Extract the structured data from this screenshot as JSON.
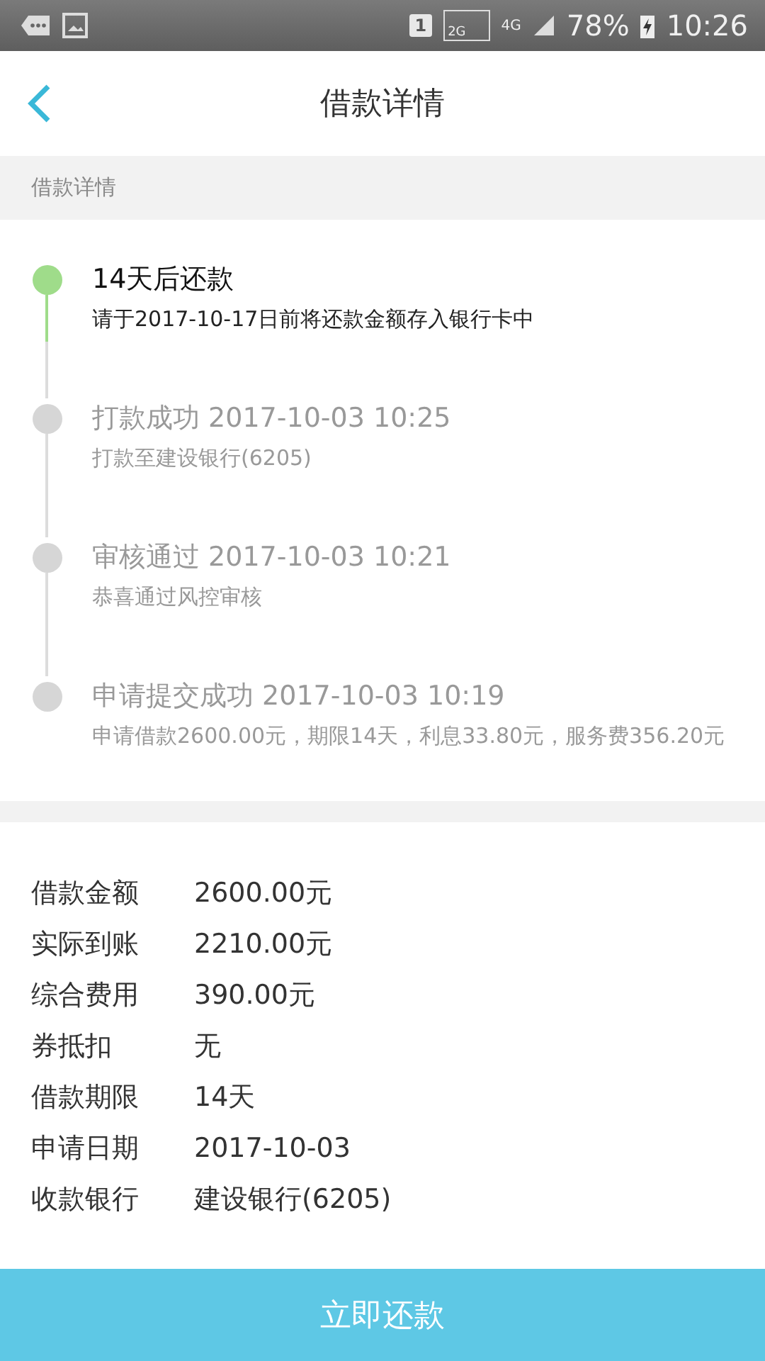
{
  "status_bar": {
    "sim": "1",
    "network_2g": "2G",
    "network_4g": "4G",
    "battery": "78%",
    "time": "10:26"
  },
  "header": {
    "title": "借款详情"
  },
  "section_label": "借款详情",
  "timeline": [
    {
      "title": "14天后还款",
      "subtitle": "请于2017-10-17日前将还款金额存入银行卡中",
      "selected": true
    },
    {
      "title": "打款成功 2017-10-03 10:25",
      "subtitle": "打款至建设银行(6205)",
      "selected": false
    },
    {
      "title": "审核通过 2017-10-03 10:21",
      "subtitle": "恭喜通过风控审核",
      "selected": false
    },
    {
      "title": "申请提交成功 2017-10-03 10:19",
      "subtitle": "申请借款2600.00元，期限14天，利息33.80元，服务费356.20元",
      "selected": false
    }
  ],
  "details": [
    {
      "label": "借款金额",
      "value": "2600.00元"
    },
    {
      "label": "实际到账",
      "value": "2210.00元"
    },
    {
      "label": "综合费用",
      "value": "390.00元"
    },
    {
      "label": "券抵扣",
      "value": "无"
    },
    {
      "label": "借款期限",
      "value": "14天"
    },
    {
      "label": "申请日期",
      "value": "2017-10-03"
    },
    {
      "label": "收款银行",
      "value": "建设银行(6205)"
    }
  ],
  "repay_button": "立即还款"
}
